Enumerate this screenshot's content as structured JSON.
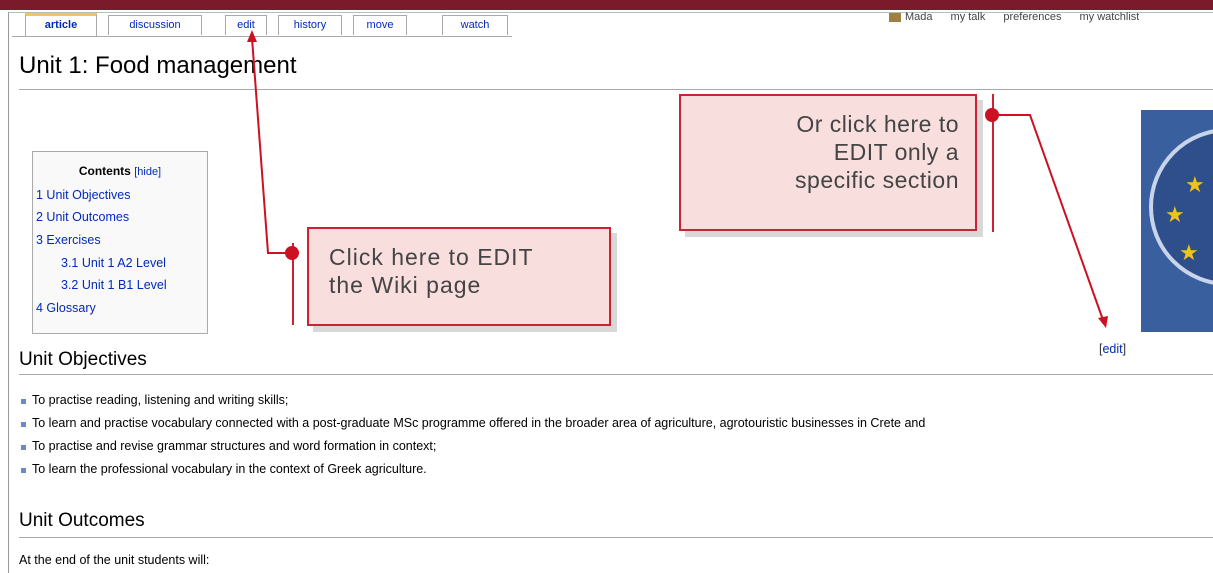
{
  "personal_tools": [
    "Mada",
    "my talk",
    "preferences",
    "my watchlist"
  ],
  "tabs": [
    {
      "label": "article",
      "active": true
    },
    {
      "label": "discussion",
      "active": false
    },
    {
      "label": "edit",
      "active": false
    },
    {
      "label": "history",
      "active": false
    },
    {
      "label": "move",
      "active": false
    },
    {
      "label": "watch",
      "active": false
    }
  ],
  "page": {
    "title": "Unit 1: Food management"
  },
  "toc": {
    "title": "Contents",
    "hide_label": "[hide]",
    "items": [
      "1 Unit Objectives",
      "2 Unit Outcomes",
      "3 Exercises",
      "3.1 Unit 1 A2 Level",
      "3.2 Unit 1 B1 Level",
      "4 Glossary"
    ]
  },
  "callouts": {
    "edit_page": [
      "Click here to EDIT",
      "the Wiki page"
    ],
    "edit_section": [
      "Or click here to",
      "EDIT only a",
      "specific section"
    ]
  },
  "section_edit": {
    "open": "[",
    "link": "edit",
    "close": "]"
  },
  "sections": {
    "objectives": {
      "heading": "Unit Objectives",
      "bullets": [
        "To practise reading, listening and writing skills;",
        "To learn and practise vocabulary connected with a post-graduate MSc programme offered in the broader area of agriculture, agrotouristic businesses in Crete and",
        "To practise and revise grammar structures and word formation in context;",
        "To learn the professional vocabulary in the context of Greek agriculture."
      ]
    },
    "outcomes": {
      "heading": "Unit Outcomes",
      "intro": "At the end of the unit students will:"
    }
  },
  "colors": {
    "accent_red": "#cc2233",
    "callout_fill": "#f9dede",
    "link_blue": "#002bb8",
    "logo_blue": "#3a5f9f"
  }
}
